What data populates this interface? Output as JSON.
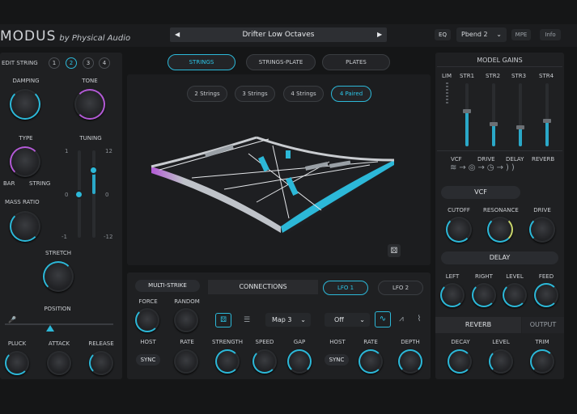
{
  "header": {
    "logo_text": "MODUS",
    "logo_by": "by Physical Audio",
    "preset_name": "Drifter Low Octaves",
    "prev_arrow": "◀",
    "next_arrow": "▶",
    "eq_label": "EQ",
    "pbend_value": "Pbend 2",
    "mpe_label": "MPE",
    "info_label": "Info"
  },
  "left": {
    "edit_string_label": "EDIT STRING",
    "string_numbers": [
      "1",
      "2",
      "3",
      "4"
    ],
    "selected_string": "2",
    "damping_label": "DAMPING",
    "tone_label": "TONE",
    "type_label": "TYPE",
    "bar_label": "BAR",
    "string_label": "STRING",
    "tuning_label": "TUNING",
    "tuning_ticks_left": [
      "1",
      "0",
      "-1"
    ],
    "tuning_ticks_right": [
      "12",
      "0",
      "-12"
    ],
    "mass_ratio_label": "MASS RATIO",
    "stretch_label": "STRETCH",
    "position_label": "POSITION",
    "pluck_label": "PLUCK",
    "attack_label": "ATTACK",
    "release_label": "RELEASE"
  },
  "center": {
    "model_tabs": [
      "STRINGS",
      "STRINGS-PLATE",
      "PLATES"
    ],
    "active_model_tab": "STRINGS",
    "string_modes": [
      "2 Strings",
      "3 Strings",
      "4 Strings",
      "4 Paired"
    ],
    "active_string_mode": "4 Paired"
  },
  "bottom": {
    "multi_strike_label": "MULTI-STRIKE",
    "force_label": "FORCE",
    "random_label": "RANDOM",
    "host_label": "HOST",
    "rate_label": "RATE",
    "sync_label": "SYNC",
    "connections_label": "CONNECTIONS",
    "map_value": "Map 3",
    "strength_label": "STRENGTH",
    "speed_label": "SPEED",
    "gap_label": "GAP",
    "lfo1_label": "LFO 1",
    "lfo2_label": "LFO 2",
    "lfo_off_value": "Off",
    "lfo_host_label": "HOST",
    "lfo_rate_label": "RATE",
    "depth_label": "DEPTH",
    "lfo_sync_label": "SYNC"
  },
  "right": {
    "model_gains_label": "MODEL GAINS",
    "lim_label": "LIM",
    "str_labels": [
      "STR1",
      "STR2",
      "STR3",
      "STR4"
    ],
    "str_gain_levels": [
      0.55,
      0.35,
      0.3,
      0.4
    ],
    "chain": [
      "VCF",
      "DRIVE",
      "DELAY",
      "REVERB"
    ],
    "vcf_label": "VCF",
    "cutoff_label": "CUTOFF",
    "resonance_label": "RESONANCE",
    "drive_label": "DRIVE",
    "delay_label": "DELAY",
    "left_label": "LEFT",
    "right_label": "RIGHT",
    "level_label": "LEVEL",
    "feed_label": "FEED",
    "reverb_label": "REVERB",
    "output_label": "OUTPUT",
    "decay_label": "DECAY",
    "rev_level_label": "LEVEL",
    "trim_label": "TRIM"
  },
  "colors": {
    "accent_blue": "#2cc6e8",
    "accent_purple": "#b35ad6",
    "background": "#151617",
    "panel": "#1f2022"
  }
}
